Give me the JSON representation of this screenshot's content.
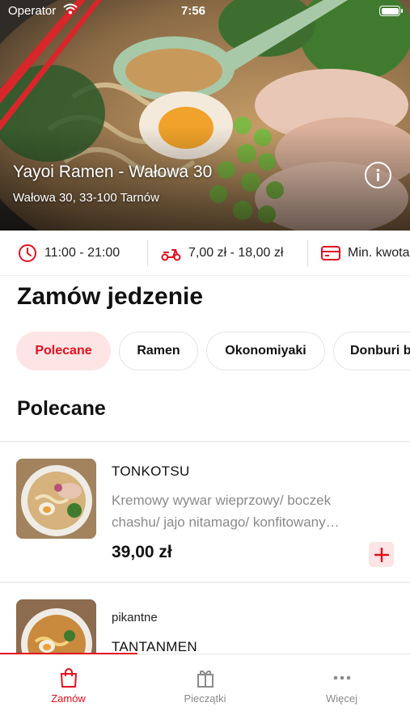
{
  "status_bar": {
    "carrier": "Operator",
    "time": "7:56"
  },
  "restaurant": {
    "name": "Yayoi Ramen - Wałowa 30",
    "address": "Wałowa 30, 33-100 Tarnów"
  },
  "info": {
    "hours": "11:00 - 21:00",
    "delivery_cost": "7,00 zł - 18,00 zł",
    "min_order": "Min. kwota"
  },
  "page_title": "Zamów jedzenie",
  "categories": [
    {
      "label": "Polecane",
      "active": true
    },
    {
      "label": "Ramen",
      "active": false
    },
    {
      "label": "Okonomiyaki",
      "active": false
    },
    {
      "label": "Donburi b",
      "active": false
    }
  ],
  "section_title": "Polecane",
  "menu_items": [
    {
      "name": "TONKOTSU",
      "description_line1": "Kremowy wywar wieprzowy/ boczek",
      "description_line2": "chashu/ jajo nitamago/ konfitowany…",
      "price": "39,00 zł",
      "add_label": "+"
    },
    {
      "tag": "pikantne",
      "name": "TANTANMEN"
    }
  ],
  "tab_bar": [
    {
      "label": "Zamów",
      "icon": "bag-icon",
      "active": true
    },
    {
      "label": "Pieczątki",
      "icon": "gift-icon",
      "active": false
    },
    {
      "label": "Więcej",
      "icon": "more-dots-icon",
      "active": false
    }
  ],
  "colors": {
    "accent": "#e3101d",
    "accent_light": "#fde4e5",
    "muted_text": "#8a8a8a"
  }
}
